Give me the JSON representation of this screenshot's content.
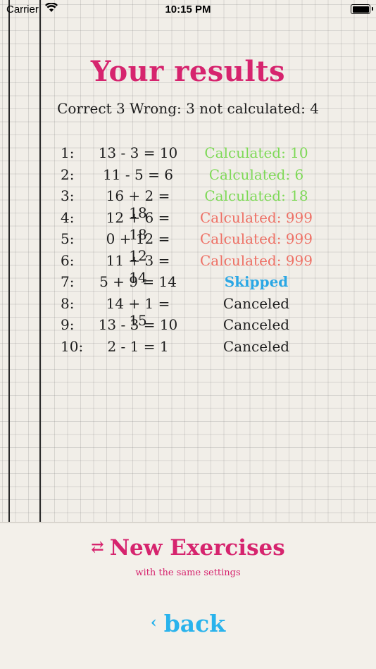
{
  "status_bar": {
    "carrier": "Carrier",
    "time": "10:15 PM"
  },
  "title": "Your results",
  "summary": "Correct 3 Wrong: 3 not calculated: 4",
  "results": [
    {
      "num": "1:",
      "expr": "13 - 3 = 10",
      "status": "Calculated: 10",
      "kind": "ok"
    },
    {
      "num": "2:",
      "expr": "11 - 5 = 6",
      "status": "Calculated: 6",
      "kind": "ok"
    },
    {
      "num": "3:",
      "expr": "16 + 2 = 18",
      "status": "Calculated: 18",
      "kind": "ok"
    },
    {
      "num": "4:",
      "expr": "12 + 6 = 18",
      "status": "Calculated: 999",
      "kind": "bad"
    },
    {
      "num": "5:",
      "expr": "0 + 12 = 12",
      "status": "Calculated: 999",
      "kind": "bad"
    },
    {
      "num": "6:",
      "expr": "11 + 3 = 14",
      "status": "Calculated: 999",
      "kind": "bad"
    },
    {
      "num": "7:",
      "expr": "5 + 9 = 14",
      "status": "Skipped",
      "kind": "skip"
    },
    {
      "num": "8:",
      "expr": "14 + 1 = 15",
      "status": "Canceled",
      "kind": "cancel"
    },
    {
      "num": "9:",
      "expr": "13 - 3 = 10",
      "status": "Canceled",
      "kind": "cancel"
    },
    {
      "num": "10:",
      "expr": "2 - 1 = 1",
      "status": "Canceled",
      "kind": "cancel"
    }
  ],
  "actions": {
    "new_exercises": "New Exercises",
    "new_exercises_sub": "with the same settings",
    "back": "back"
  },
  "colors": {
    "title": "#d6246e",
    "ok": "#7ed957",
    "bad": "#ee7065",
    "skip": "#2ba7e4",
    "back": "#29b3ec"
  },
  "icons": {
    "repeat": "repeat-icon",
    "back": "chevron-left-icon",
    "wifi": "wifi-icon",
    "battery": "battery-icon"
  }
}
